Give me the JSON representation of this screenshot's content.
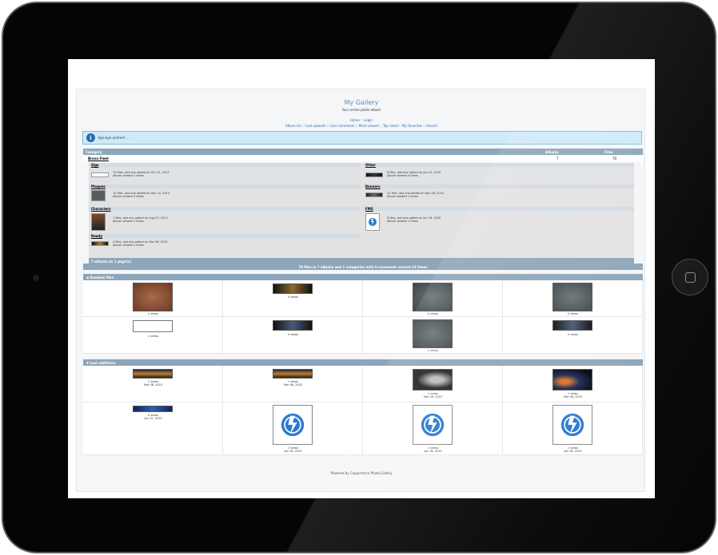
{
  "colors": {
    "bezel": "#050505",
    "header_bar": "#8ea6b9",
    "info_bg": "#cfeaf7",
    "title": "#5b8db8",
    "link": "#3a67b0"
  },
  "gallery": {
    "title": "My Gallery",
    "subtitle": "Your online photo album",
    "nav_top": "Home :: Login",
    "nav_main": "Album list :: Last uploads :: Last comments :: Most viewed :: Top rated :: My Favorites :: Search"
  },
  "info_message": "Bye bye andrevf ...",
  "category_table": {
    "headers": {
      "category": "Category",
      "albums": "Albums",
      "files": "Files"
    },
    "row": {
      "name": "Bravo Fleet",
      "albums": "7",
      "files": "70"
    }
  },
  "albums": [
    {
      "name": "Sigs",
      "line1": "13 files, last one added on Oct 24, 2014",
      "line2": "Album viewed 2 times"
    },
    {
      "name": "Other",
      "line1": "8 files, last one added on Jan 22, 2015",
      "line2": "Album viewed 0 times"
    },
    {
      "name": "Plaques",
      "line1": "10 files, last one added on Dec 14, 2014",
      "line2": "Album viewed 0 times"
    },
    {
      "name": "Banners",
      "line1": "21 files, last one added on Nov 26, 2014",
      "line2": "Album viewed 1 times"
    },
    {
      "name": "Characters",
      "line1": "1 files, last one added on Aug 07, 2014",
      "line2": "Album viewed 1 times"
    },
    {
      "name": "FMS",
      "line1": "6 files, last one added on Jan 16, 2015",
      "line2": "Album viewed 1 times"
    },
    {
      "name": "Ready",
      "line1": "4 files, last one added on Mar 06, 2015",
      "line2": "Album viewed 2 times"
    }
  ],
  "albums_footer": "7 albums on 1 page(s)",
  "stats_line": "70 files in 7 albums and 1 categories with 0 comments viewed 32 times",
  "random_files": {
    "title": "Random files",
    "items": [
      {
        "views": "2 views",
        "kind": "plaque-bronze"
      },
      {
        "views": "0 views",
        "kind": "banner-dark"
      },
      {
        "views": "0 views",
        "kind": "plaque-gray"
      },
      {
        "views": "0 views",
        "kind": "plaque-gray"
      },
      {
        "views": "1 views",
        "kind": "banner-white"
      },
      {
        "views": "0 views",
        "kind": "banner-dark"
      },
      {
        "views": "1 views",
        "kind": "plaque-gray"
      },
      {
        "views": "0 views",
        "kind": "banner-dark"
      }
    ]
  },
  "last_additions": {
    "title": "Last additions",
    "items": [
      {
        "views": "2 views",
        "date": "Mar 06, 2015",
        "kind": "banner-sunset"
      },
      {
        "views": "1 views",
        "date": "Mar 06, 2015",
        "kind": "banner-sunset"
      },
      {
        "views": "1 views",
        "date": "Mar 06, 2015",
        "kind": "space-ship"
      },
      {
        "views": "1 views",
        "date": "Mar 06, 2015",
        "kind": "space-planet"
      },
      {
        "views": "0 views",
        "date": "Jan 22, 2015",
        "kind": "banner-blue"
      },
      {
        "views": "1 views",
        "date": "Jan 16, 2015",
        "kind": "fms-logo"
      },
      {
        "views": "1 views",
        "date": "Jan 16, 2015",
        "kind": "fms-logo"
      },
      {
        "views": "1 views",
        "date": "Jan 16, 2015",
        "kind": "fms-logo"
      }
    ]
  },
  "footer": "Powered by Coppermine Photo Gallery"
}
